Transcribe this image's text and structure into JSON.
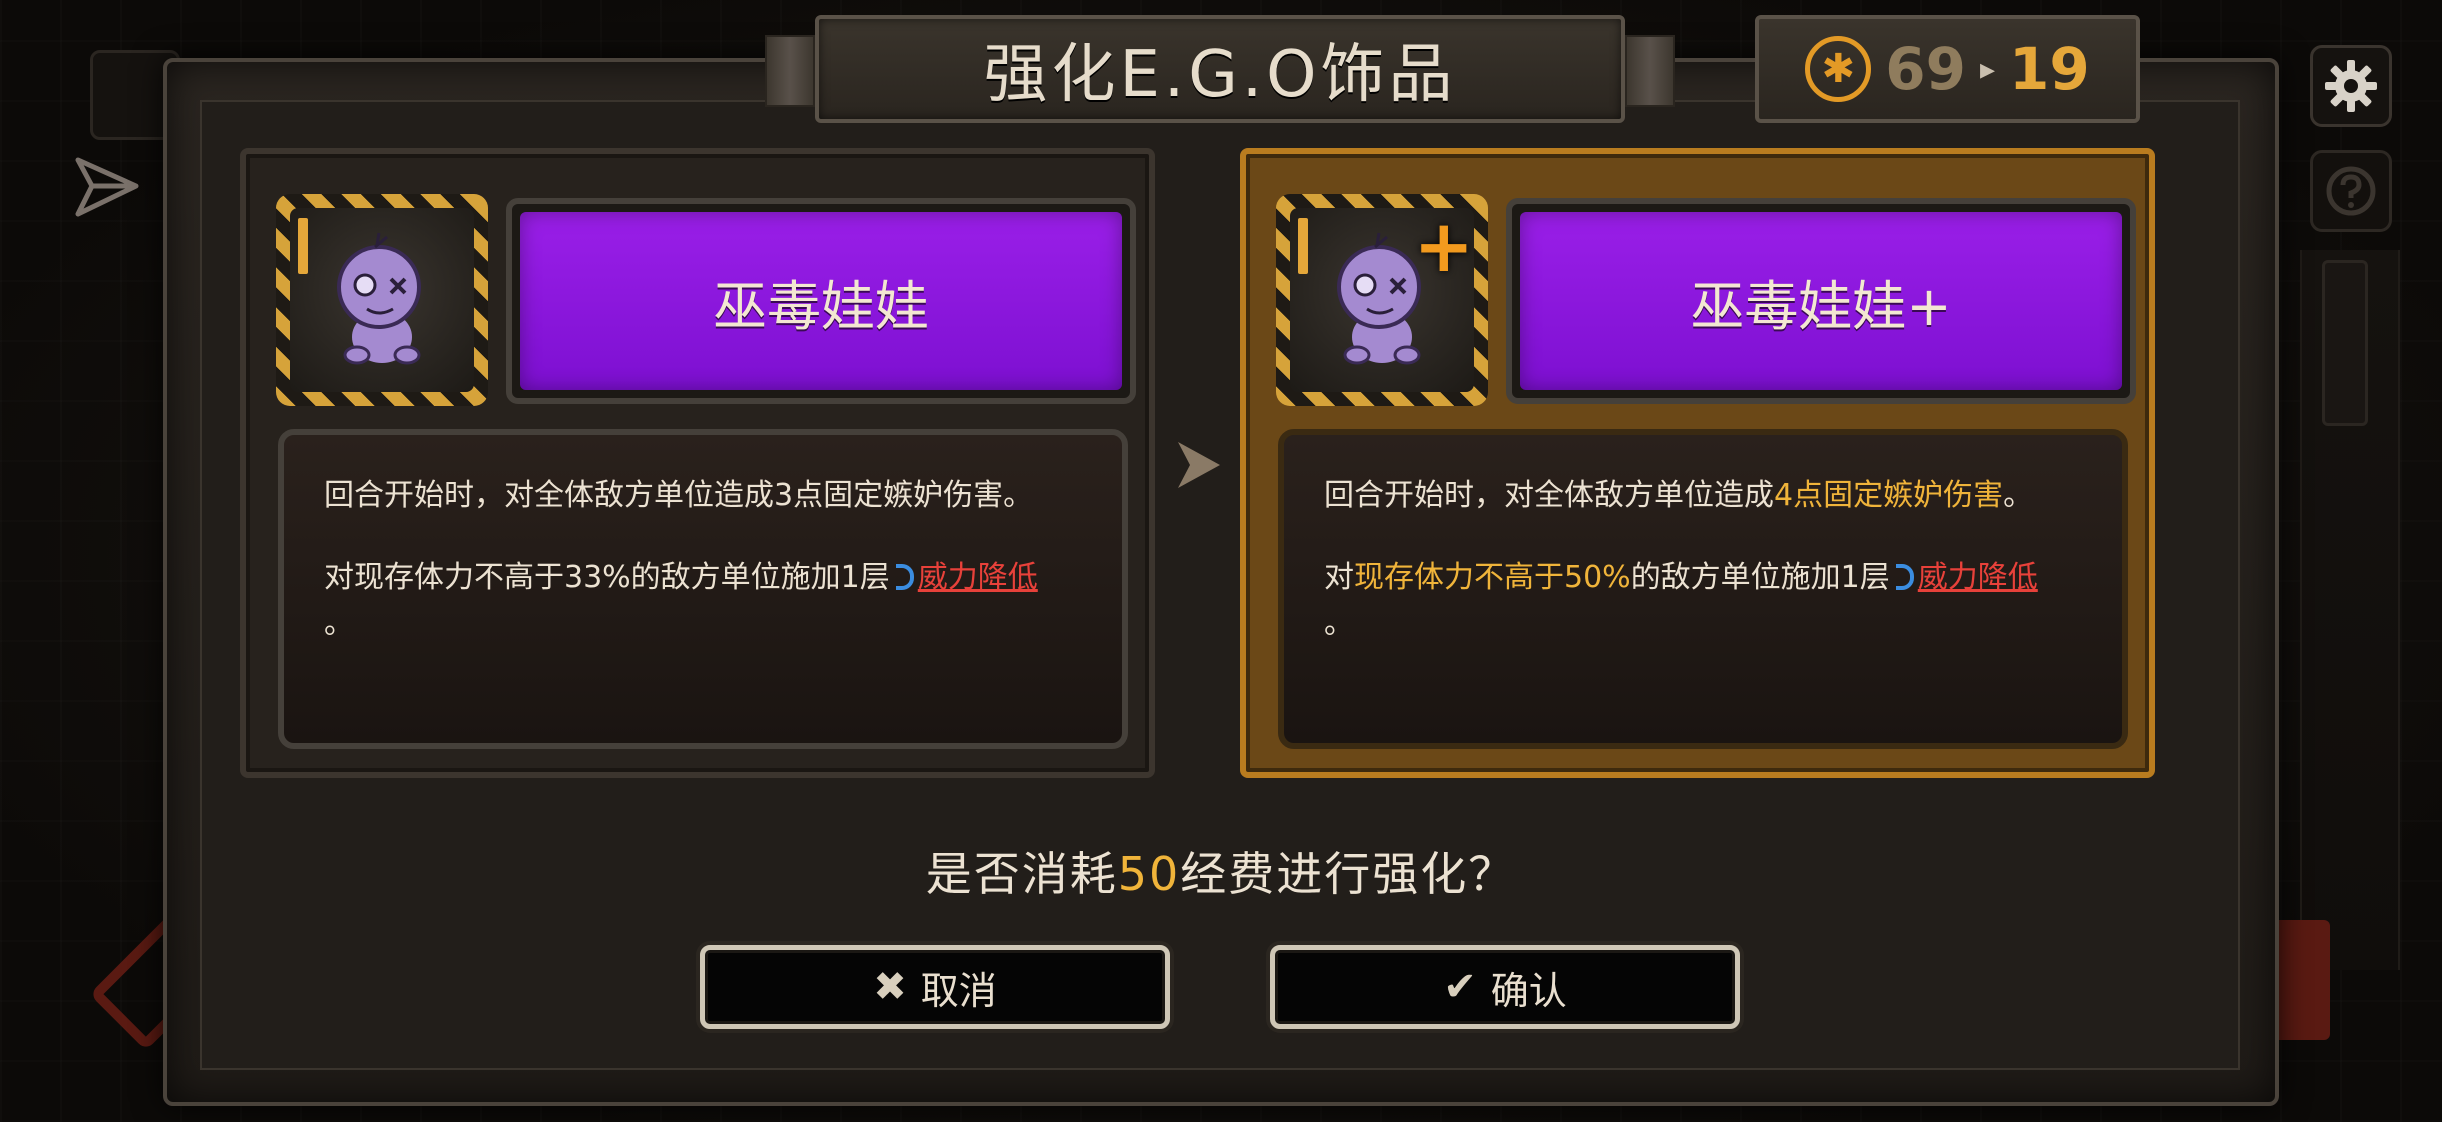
{
  "dialog": {
    "title": "强化E.G.O饰品",
    "cost": {
      "icon": "gear-coin-icon",
      "current": "69",
      "arrow": "▸",
      "after": "19"
    }
  },
  "before": {
    "name": "巫毒娃娃",
    "tier": "I",
    "desc_line1": "回合开始时，对全体敌方单位造成3点固定嫉妒伤害。",
    "desc_line2_pre": "对现存体力不高于33%的敌方单位施加1层",
    "desc_keyword": "威力降低",
    "desc_line3": "。"
  },
  "after": {
    "name": "巫毒娃娃+",
    "tier": "I",
    "plus": "+",
    "desc_line1_pre": "回合开始时，对全体敌方单位造成",
    "desc_line1_hl": "4点固定嫉妒伤害",
    "desc_line1_post": "。",
    "desc_line2_pre": "对",
    "desc_line2_hl": "现存体力不高于50%",
    "desc_line2_mid": "的敌方单位施加1层",
    "desc_keyword": "威力降低",
    "desc_line3": "。"
  },
  "prompt": {
    "pre": "是否消耗",
    "amount": "50",
    "post": "经费进行强化？"
  },
  "buttons": {
    "cancel": "取消",
    "confirm": "确认"
  },
  "colors": {
    "accent_gold": "#f0b43a",
    "rarity_purple": "#8a16de",
    "keyword_red": "#e8413a",
    "keyword_icon_blue": "#3b8de0",
    "upgrade_frame": "#b97c1f"
  }
}
